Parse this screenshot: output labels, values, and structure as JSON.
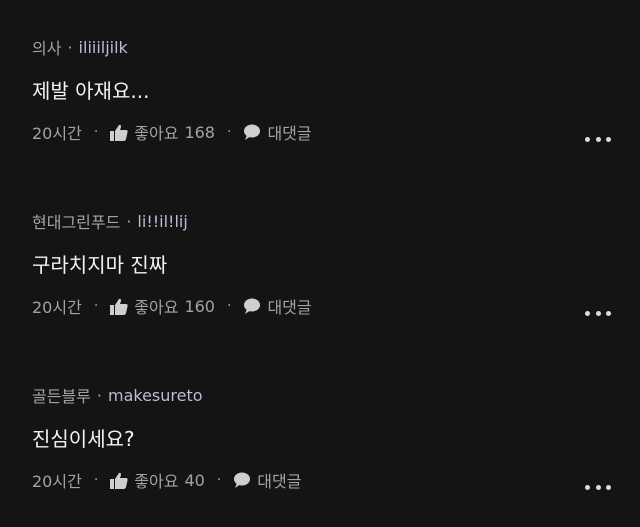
{
  "comments": [
    {
      "author": "의사",
      "handle": "iliiiljilk",
      "text": "제발 아재요...",
      "time": "20시간",
      "like_label": "좋아요",
      "like_count": "168",
      "reply_label": "대댓글"
    },
    {
      "author": "현대그린푸드",
      "handle": "li!!il!lij",
      "text": "구라치지마 진짜",
      "time": "20시간",
      "like_label": "좋아요",
      "like_count": "160",
      "reply_label": "대댓글"
    },
    {
      "author": "골든블루",
      "handle": "makesureto",
      "text": "진심이세요?",
      "time": "20시간",
      "like_label": "좋아요",
      "like_count": "40",
      "reply_label": "대댓글"
    }
  ],
  "separator": "·",
  "icons": {
    "like": "thumbs-up-icon",
    "reply": "speech-bubble-icon",
    "more": "more-options-icon"
  }
}
